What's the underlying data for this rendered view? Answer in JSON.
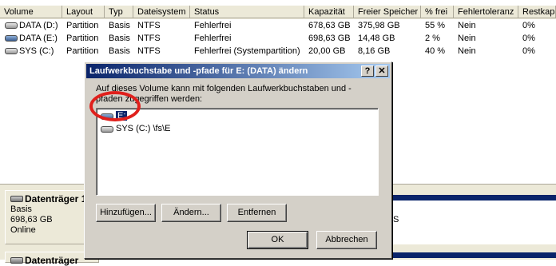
{
  "columns": [
    "Volume",
    "Layout",
    "Typ",
    "Dateisystem",
    "Status",
    "Kapazität",
    "Freier Speicher",
    "% frei",
    "Fehlertoleranz",
    "Restkapa"
  ],
  "volumes": [
    {
      "name": "DATA (D:)",
      "layout": "Partition",
      "typ": "Basis",
      "fs": "NTFS",
      "status": "Fehlerfrei",
      "capacity": "678,63 GB",
      "free": "375,98 GB",
      "pct": "55 %",
      "fault": "Nein",
      "rest": "0%",
      "icon": "drive-icon"
    },
    {
      "name": "DATA (E:)",
      "layout": "Partition",
      "typ": "Basis",
      "fs": "NTFS",
      "status": "Fehlerfrei",
      "capacity": "698,63 GB",
      "free": "14,48 GB",
      "pct": "2 %",
      "fault": "Nein",
      "rest": "0%",
      "icon": "drive-icon-blue"
    },
    {
      "name": "SYS (C:)",
      "layout": "Partition",
      "typ": "Basis",
      "fs": "NTFS",
      "status": "Fehlerfrei (Systempartition)",
      "capacity": "20,00 GB",
      "free": "8,16 GB",
      "pct": "40 %",
      "fault": "Nein",
      "rest": "0%",
      "icon": "drive-icon"
    }
  ],
  "disks": [
    {
      "title": "Datenträger 1",
      "type": "Basis",
      "size": "698,63 GB",
      "state": "Online"
    },
    {
      "title": "Datenträger"
    }
  ],
  "disk_right_text": "S",
  "dialog": {
    "title": "Laufwerkbuchstabe und -pfade für E: (DATA) ändern",
    "help": "?",
    "close": "✕",
    "description": "Auf dieses Volume kann mit folgenden Laufwerkbuchstaben und -pfaden zugegriffen werden:",
    "items": [
      "E:",
      "SYS (C:) \\fs\\E"
    ],
    "buttons": {
      "add": "Hinzufügen...",
      "change": "Ändern...",
      "remove": "Entfernen",
      "ok": "OK",
      "cancel": "Abbrechen"
    }
  },
  "colors": {
    "highlight": "#0a246a",
    "annotation": "#e0201c"
  }
}
